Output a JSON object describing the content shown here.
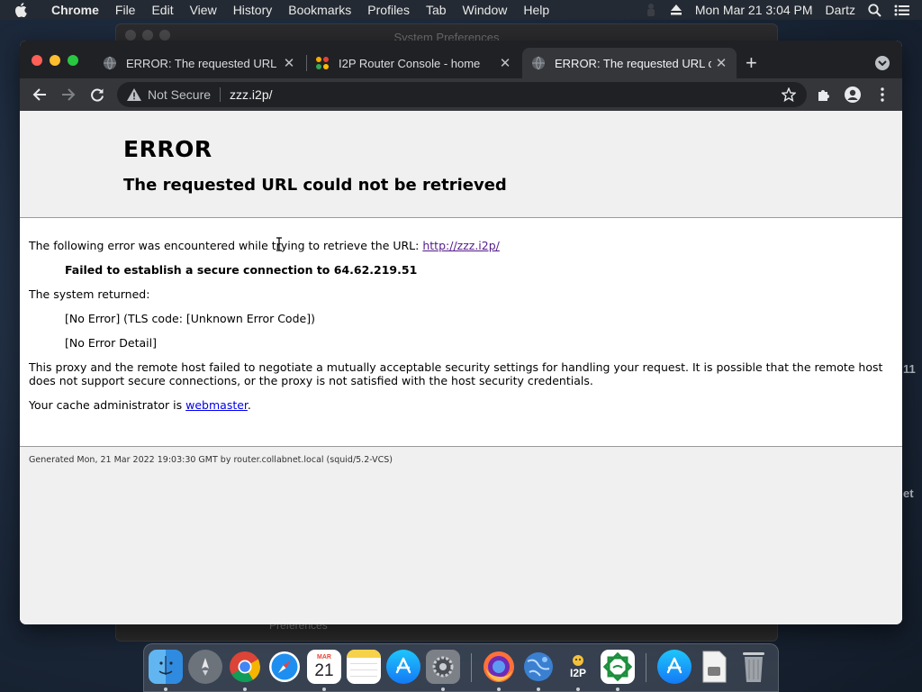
{
  "menubar": {
    "app_name": "Chrome",
    "items": [
      "File",
      "Edit",
      "View",
      "History",
      "Bookmarks",
      "Profiles",
      "Tab",
      "Window",
      "Help"
    ],
    "clock": "Mon Mar 21  3:04 PM",
    "user": "Dartz"
  },
  "background_window": {
    "title": "System Preferences",
    "footer": "Preferences",
    "edge_text_1": "11",
    "edge_text_2": "et"
  },
  "browser": {
    "tabs": [
      {
        "title": "ERROR: The requested URL could not be retrieved",
        "favicon": "globe-icon",
        "active": false
      },
      {
        "title": "I2P Router Console - home",
        "favicon": "i2p-icon",
        "active": false
      },
      {
        "title": "ERROR: The requested URL could not be retrieved",
        "favicon": "globe-icon",
        "active": true
      }
    ],
    "close_glyph": "✕",
    "new_tab_glyph": "+",
    "security_label": "Not Secure",
    "url": "zzz.i2p/"
  },
  "page": {
    "heading": "ERROR",
    "subheading": "The requested URL could not be retrieved",
    "intro_text": "The following error was encountered while trying to retrieve the URL:",
    "intro_link": "http://zzz.i2p/",
    "error_bold": "Failed to establish a secure connection to 64.62.219.51",
    "system_returned": "The system returned:",
    "no_error": "[No Error] (TLS code: [Unknown Error Code])",
    "no_error_detail": "[No Error Detail]",
    "explanation": "This proxy and the remote host failed to negotiate a mutually acceptable security settings for handling your request. It is possible that the remote host does not support secure connections, or the proxy is not satisfied with the host security credentials.",
    "admin_prefix": "Your cache administrator is",
    "admin_link": "webmaster",
    "admin_suffix": ".",
    "footer": "Generated Mon, 21 Mar 2022 19:03:30 GMT by router.collabnet.local (squid/5.2-VCS)"
  },
  "dock": {
    "calendar_month": "MAR",
    "calendar_day": "21",
    "i2p_label": "I2P",
    "items": [
      "finder",
      "launchpad",
      "chrome",
      "safari",
      "calendar",
      "notes",
      "app-store",
      "system-preferences",
      "firefox",
      "network-radar",
      "i2p",
      "app",
      "app-store-2",
      "downloads",
      "trash"
    ]
  },
  "colors": {
    "tab_strip": "#202124",
    "toolbar": "#35363a",
    "link_visited": "#551a8b",
    "link": "#0000ee"
  }
}
